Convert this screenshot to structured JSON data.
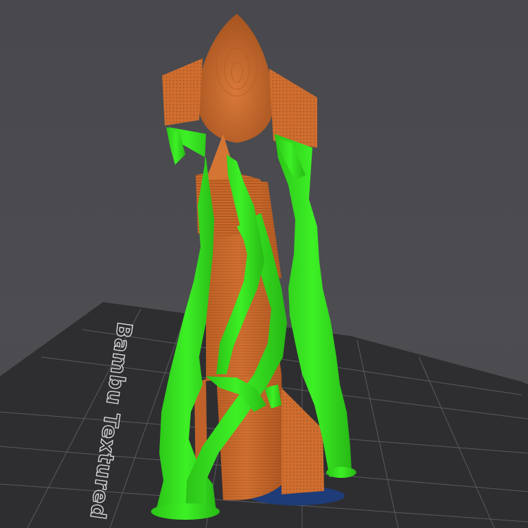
{
  "viewport": {
    "background_color": "#4b4b50"
  },
  "build_plate": {
    "label": "Bambu Textured",
    "surface_color": "#2e2e31",
    "grid_color": "#66666b",
    "label_color": "#d8d8d8"
  },
  "model": {
    "part_color": "#c8672a",
    "support_color": "#33e41c",
    "brim_color": "#1e3c78",
    "icons": {
      "rocket": "rocket-model-icon",
      "support": "tree-support-icon"
    }
  }
}
